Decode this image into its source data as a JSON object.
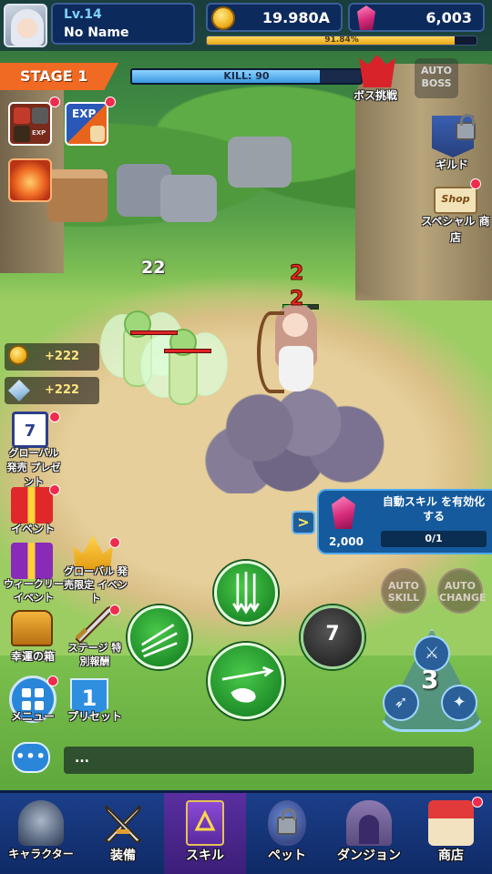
{
  "player": {
    "level": "Lv.14",
    "name": "No Name"
  },
  "currency": {
    "gold": "19.980A",
    "gems": "6,003"
  },
  "xp": {
    "percent_text": "91.84%",
    "fraction": 0.9184
  },
  "stage": {
    "label": "STAGE 1"
  },
  "kill": {
    "label": "KILL: 90",
    "fraction": 0.82
  },
  "top_right": {
    "boss_challenge": "ボス挑戦",
    "auto_boss": "AUTO BOSS",
    "guild": "ギルド",
    "shop_badge": "Shop",
    "special_shop": "スペシャル 商店"
  },
  "left_top_icons": {
    "exp_label": "EXP",
    "small_exp": "EXP"
  },
  "rewards": [
    {
      "icon": "gold-coin-icon",
      "value": "+222"
    },
    {
      "icon": "crystal-icon",
      "value": "+222"
    }
  ],
  "damage_numbers": [
    "22",
    "2",
    "2"
  ],
  "left_menu": {
    "global_release_present": "グローバル 発売 プレゼント",
    "calendar_day": "7",
    "event": "イベント",
    "weekly_event": "ウィークリー イベント",
    "global_limited_event": "グローバル 発売限定 イベント",
    "lucky_box": "幸運の箱",
    "stage_reward": "ステージ 特別報酬",
    "menu": "メニュー",
    "preset": "プリセット",
    "preset_number": "1"
  },
  "auto_skill_popup": {
    "message": "自動スキル を有効化する",
    "cost": "2,000",
    "progress": "0/1"
  },
  "auto_buttons": {
    "auto_skill": "AUTO SKILL",
    "auto_change": "AUTO CHANGE"
  },
  "skills": {
    "cooldown": "7"
  },
  "weapon_selector": {
    "count": "3"
  },
  "chat": {
    "icon_text": "•••",
    "placeholder": "..."
  },
  "bottom_nav": [
    {
      "label": "キャラクター",
      "icon": "knight-helmet-icon"
    },
    {
      "label": "装備",
      "icon": "crossed-swords-icon"
    },
    {
      "label": "スキル",
      "icon": "spellbook-icon",
      "active": true
    },
    {
      "label": "ペット",
      "icon": "locked-egg-icon"
    },
    {
      "label": "ダンジョン",
      "icon": "dungeon-gate-icon"
    },
    {
      "label": "商店",
      "icon": "shop-stall-icon"
    }
  ],
  "colors": {
    "accent": "#f06a24",
    "hud_bg": "#0d2a5c",
    "skill_green": "#1f8f2a",
    "nav_bg": "#1c3f8a",
    "notification": "#ef2b4e"
  }
}
